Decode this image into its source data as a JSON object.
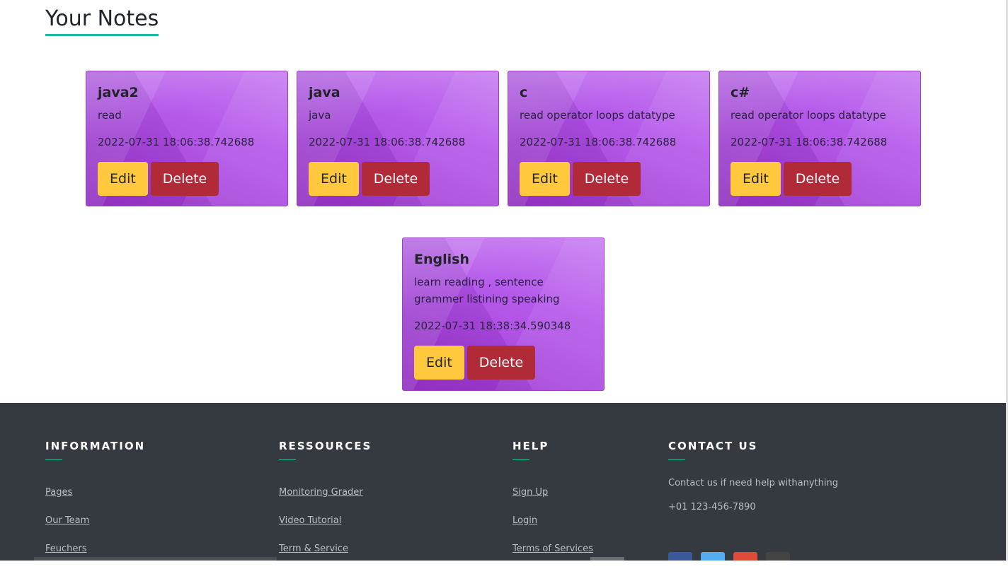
{
  "page_title": "Your Notes",
  "actions": {
    "edit_label": "Edit",
    "delete_label": "Delete"
  },
  "notes": [
    {
      "title": "java2",
      "description": "read",
      "date": "2022-07-31 18:06:38.742688"
    },
    {
      "title": "java",
      "description": "java",
      "date": "2022-07-31 18:06:38.742688"
    },
    {
      "title": "c",
      "description": "read operator loops datatype",
      "date": "2022-07-31 18:06:38.742688"
    },
    {
      "title": "c#",
      "description": "read operator loops datatype",
      "date": "2022-07-31 18:06:38.742688"
    },
    {
      "title": "English",
      "description": "learn reading , sentence grammer listining speaking",
      "date": "2022-07-31 18:38:34.590348"
    }
  ],
  "footer": {
    "information": {
      "heading": "INFORMATION",
      "links": [
        "Pages",
        "Our Team",
        "Feuchers"
      ]
    },
    "resources": {
      "heading": "RESSOURCES",
      "links": [
        "Monitoring Grader",
        "Video Tutorial",
        "Term & Service"
      ]
    },
    "help": {
      "heading": "HELP",
      "links": [
        "Sign Up",
        "Login",
        "Terms of Services"
      ]
    },
    "contact": {
      "heading": "CONTACT US",
      "text": "Contact us if need help withanything",
      "phone": "+01 123-456-7890"
    },
    "social_icons": [
      "facebook-icon",
      "twitter-icon",
      "google-plus-icon",
      "github-icon"
    ]
  },
  "colors": {
    "accent": "#1abc9c",
    "card": "#b150ea",
    "edit": "#ffc83d",
    "delete": "#b02a37",
    "footer_bg": "#343a40"
  }
}
